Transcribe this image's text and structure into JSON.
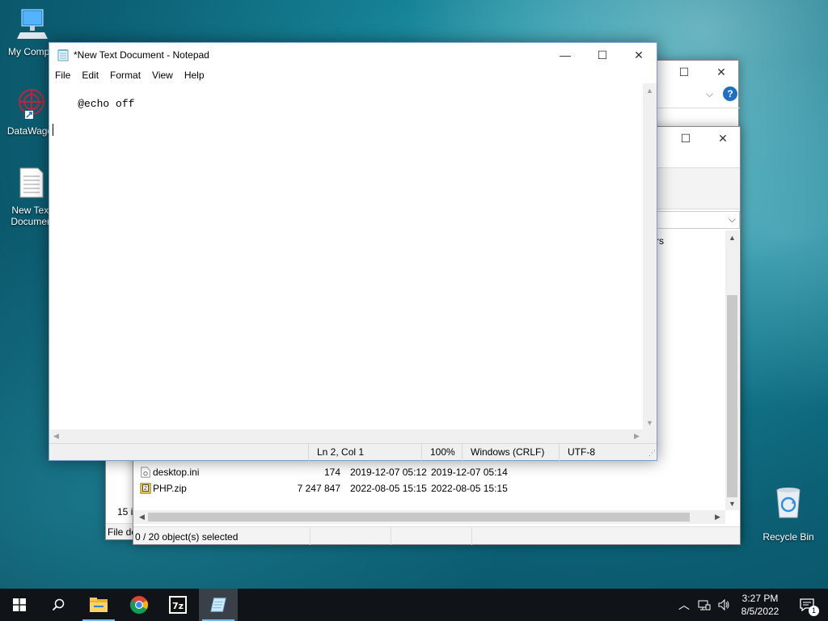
{
  "desktop": {
    "icons": [
      {
        "label": "My Compu"
      },
      {
        "label": "DataWagor"
      },
      {
        "label": "New Text Documen"
      },
      {
        "label": "Recycle Bin"
      }
    ]
  },
  "explorer_back": {
    "header_right": "rs",
    "status_left": "15 i",
    "status_bottom": "File de",
    "rows": [
      {
        "name": "desktop.ini",
        "size": "174",
        "modified": "2019-12-07 05:12",
        "created": "2019-12-07 05:14"
      },
      {
        "name": "PHP.zip",
        "size": "7 247 847",
        "modified": "2022-08-05 15:15",
        "created": "2022-08-05 15:15"
      }
    ],
    "selection_status": "0 / 20 object(s) selected"
  },
  "notepad": {
    "title": "*New Text Document - Notepad",
    "menu": [
      "File",
      "Edit",
      "Format",
      "View",
      "Help"
    ],
    "content": "@echo off",
    "status": {
      "position": "Ln 2, Col 1",
      "zoom": "100%",
      "line_endings": "Windows (CRLF)",
      "encoding": "UTF-8"
    }
  },
  "taskbar": {
    "time": "3:27 PM",
    "date": "8/5/2022",
    "notification_count": "1"
  },
  "colors": {
    "taskbar": "#101418",
    "accent": "#76b9ed",
    "help_icon": "#1f6fc5"
  }
}
